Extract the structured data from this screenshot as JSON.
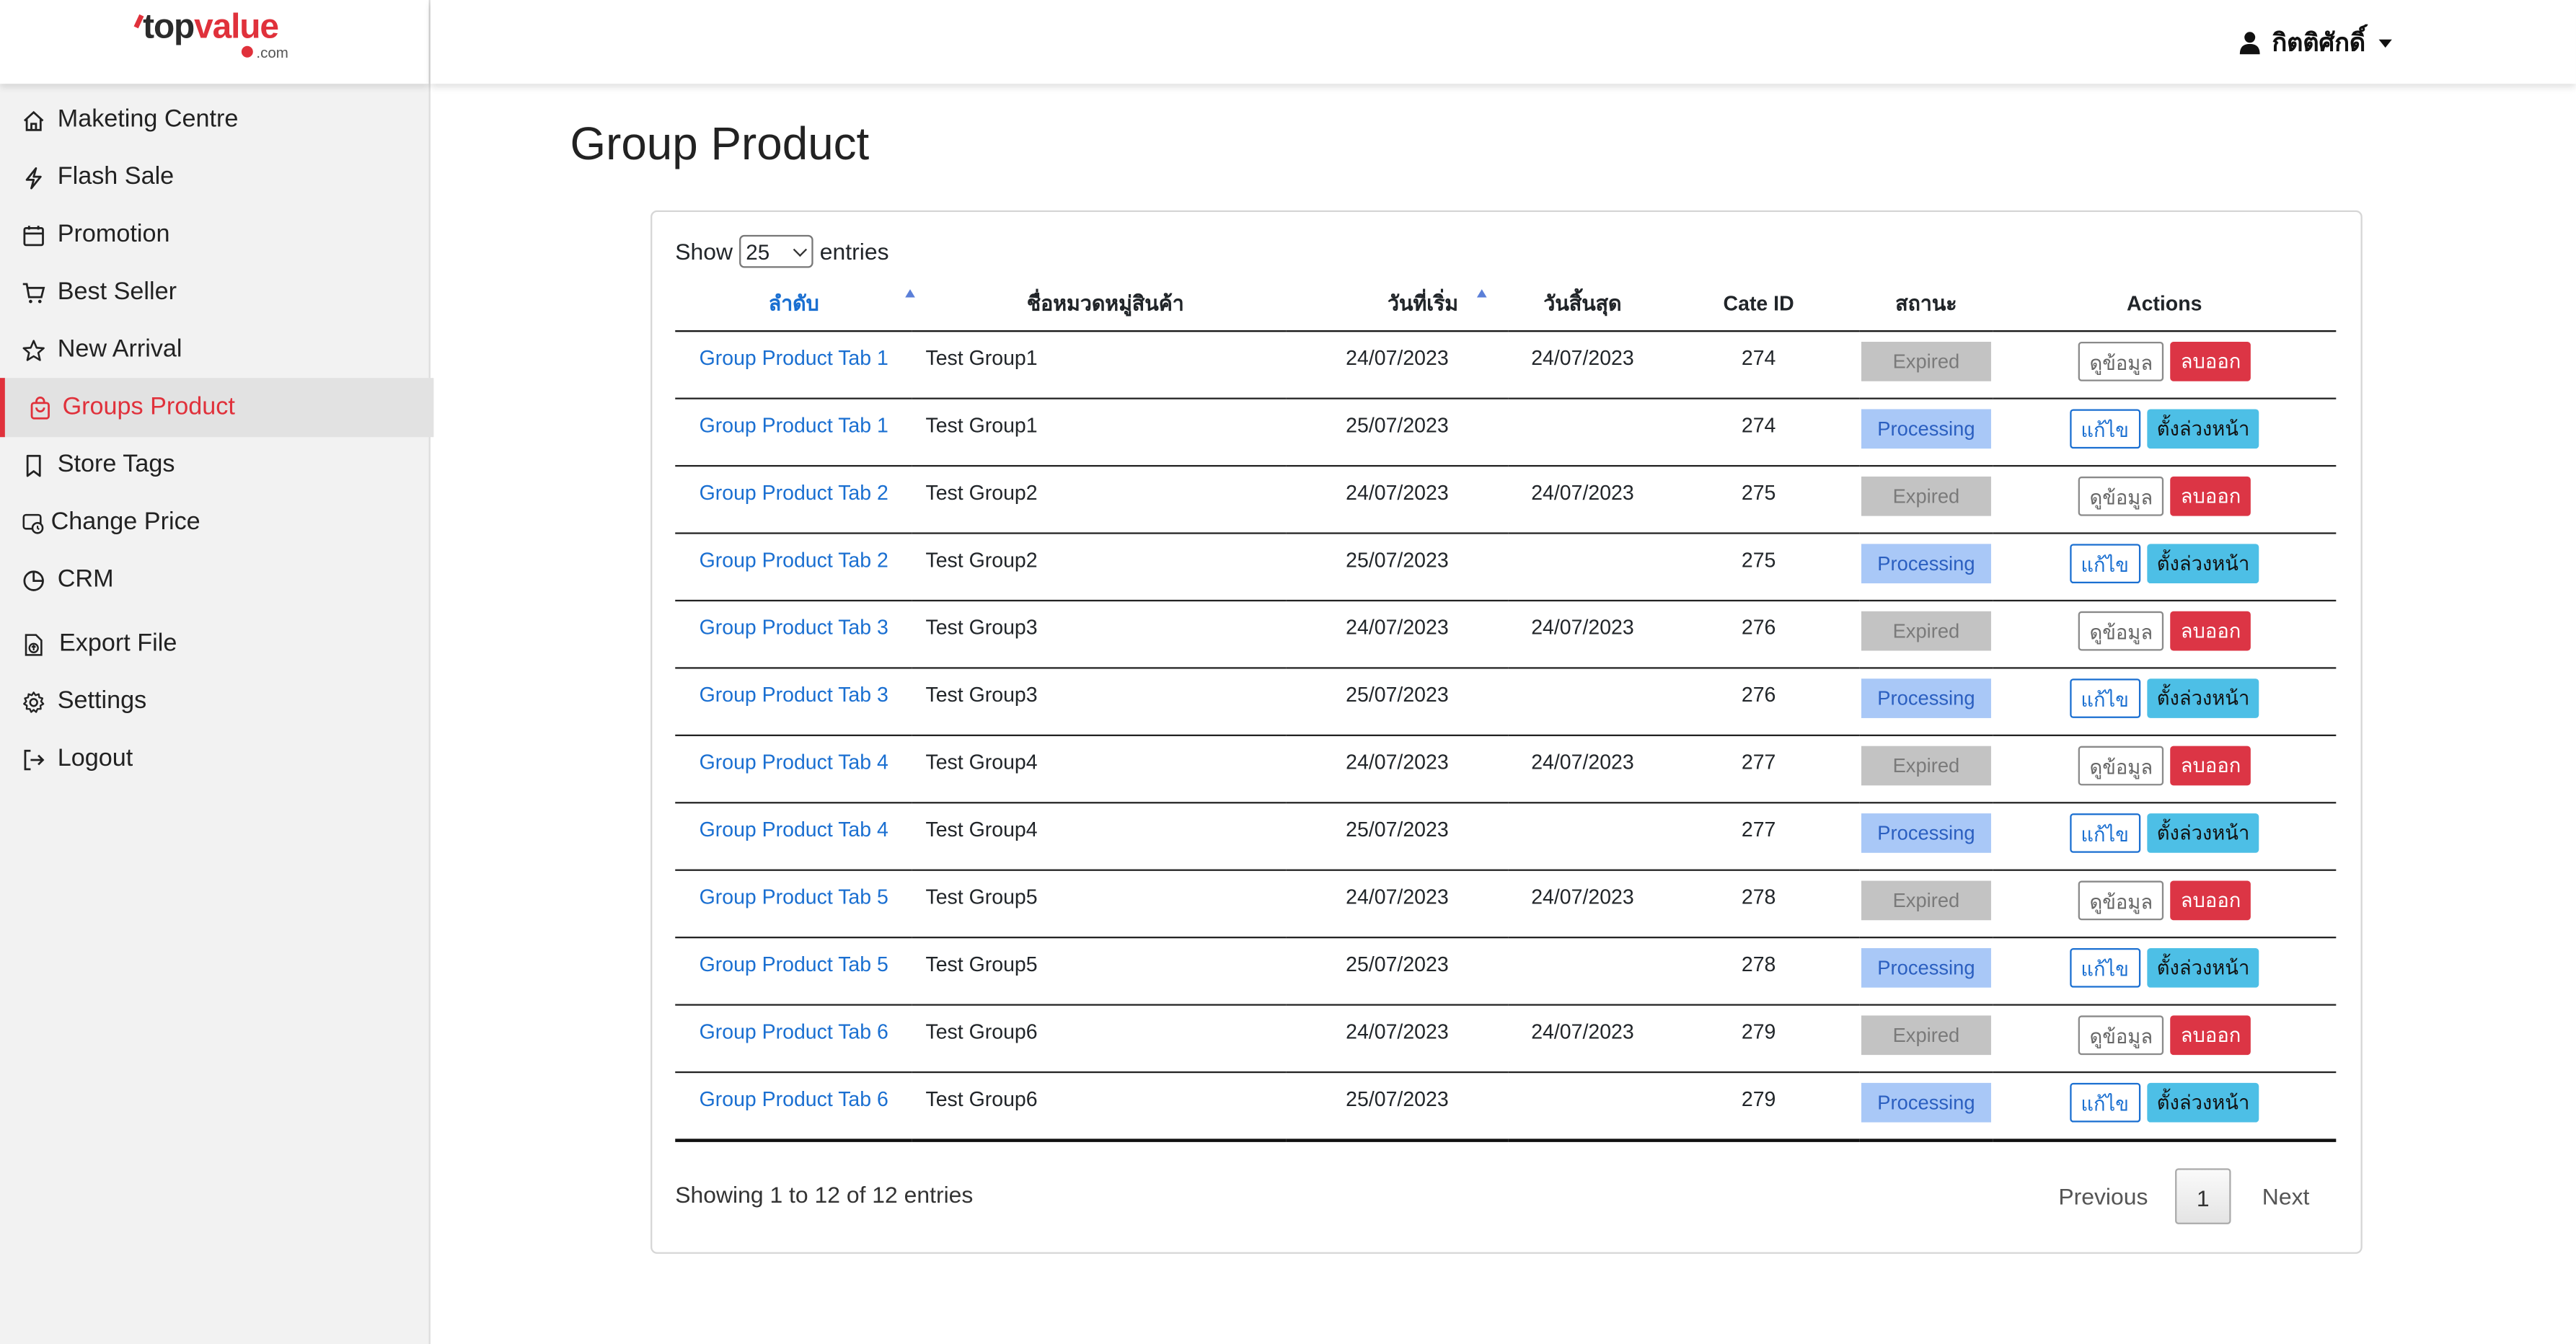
{
  "brand": {
    "logo_main": "top",
    "logo_accent": "value",
    "logo_suffix": ".com"
  },
  "user": {
    "name": "กิตติศักดิ์"
  },
  "sidebar": {
    "items": [
      {
        "label": "Maketing Centre",
        "icon": "home-icon"
      },
      {
        "label": "Flash Sale",
        "icon": "lightning-icon"
      },
      {
        "label": "Promotion",
        "icon": "calendar-icon"
      },
      {
        "label": "Best Seller",
        "icon": "cart-icon"
      },
      {
        "label": "New Arrival",
        "icon": "star-icon"
      },
      {
        "label": "Groups Product",
        "icon": "bag-icon",
        "active": true
      },
      {
        "label": "Store Tags",
        "icon": "bookmark-icon"
      },
      {
        "label": "Change Price",
        "icon": "price-tag-icon"
      },
      {
        "label": "CRM",
        "icon": "pie-chart-icon"
      },
      {
        "label": "Export File",
        "icon": "export-icon"
      },
      {
        "label": "Settings",
        "icon": "gear-icon"
      },
      {
        "label": "Logout",
        "icon": "logout-icon"
      }
    ]
  },
  "page": {
    "title": "Group Product"
  },
  "table_controls": {
    "show_label": "Show",
    "entries_value": "25",
    "entries_label": "entries"
  },
  "table": {
    "headers": [
      "ลำดับ",
      "ชื่อหมวดหมู่สินค้า",
      "วันที่เริ่ม",
      "วันสิ้นสุด",
      "Cate ID",
      "สถานะ",
      "Actions"
    ],
    "rows": [
      {
        "name": "Group Product Tab 1",
        "category": "Test Group1",
        "start": "24/07/2023",
        "end": "24/07/2023",
        "cate_id": "274",
        "status": "Expired",
        "btn1": "ดูข้อมูล",
        "btn2": "ลบออก"
      },
      {
        "name": "Group Product Tab 1",
        "category": "Test Group1",
        "start": "25/07/2023",
        "end": "",
        "cate_id": "274",
        "status": "Processing",
        "btn1": "แก้ไข",
        "btn2": "ตั้งล่วงหน้า"
      },
      {
        "name": "Group Product Tab 2",
        "category": "Test Group2",
        "start": "24/07/2023",
        "end": "24/07/2023",
        "cate_id": "275",
        "status": "Expired",
        "btn1": "ดูข้อมูล",
        "btn2": "ลบออก"
      },
      {
        "name": "Group Product Tab 2",
        "category": "Test Group2",
        "start": "25/07/2023",
        "end": "",
        "cate_id": "275",
        "status": "Processing",
        "btn1": "แก้ไข",
        "btn2": "ตั้งล่วงหน้า"
      },
      {
        "name": "Group Product Tab 3",
        "category": "Test Group3",
        "start": "24/07/2023",
        "end": "24/07/2023",
        "cate_id": "276",
        "status": "Expired",
        "btn1": "ดูข้อมูล",
        "btn2": "ลบออก"
      },
      {
        "name": "Group Product Tab 3",
        "category": "Test Group3",
        "start": "25/07/2023",
        "end": "",
        "cate_id": "276",
        "status": "Processing",
        "btn1": "แก้ไข",
        "btn2": "ตั้งล่วงหน้า"
      },
      {
        "name": "Group Product Tab 4",
        "category": "Test Group4",
        "start": "24/07/2023",
        "end": "24/07/2023",
        "cate_id": "277",
        "status": "Expired",
        "btn1": "ดูข้อมูล",
        "btn2": "ลบออก"
      },
      {
        "name": "Group Product Tab 4",
        "category": "Test Group4",
        "start": "25/07/2023",
        "end": "",
        "cate_id": "277",
        "status": "Processing",
        "btn1": "แก้ไข",
        "btn2": "ตั้งล่วงหน้า"
      },
      {
        "name": "Group Product Tab 5",
        "category": "Test Group5",
        "start": "24/07/2023",
        "end": "24/07/2023",
        "cate_id": "278",
        "status": "Expired",
        "btn1": "ดูข้อมูล",
        "btn2": "ลบออก"
      },
      {
        "name": "Group Product Tab 5",
        "category": "Test Group5",
        "start": "25/07/2023",
        "end": "",
        "cate_id": "278",
        "status": "Processing",
        "btn1": "แก้ไข",
        "btn2": "ตั้งล่วงหน้า"
      },
      {
        "name": "Group Product Tab 6",
        "category": "Test Group6",
        "start": "24/07/2023",
        "end": "24/07/2023",
        "cate_id": "279",
        "status": "Expired",
        "btn1": "ดูข้อมูล",
        "btn2": "ลบออก"
      },
      {
        "name": "Group Product Tab 6",
        "category": "Test Group6",
        "start": "25/07/2023",
        "end": "",
        "cate_id": "279",
        "status": "Processing",
        "btn1": "แก้ไข",
        "btn2": "ตั้งล่วงหน้า"
      }
    ]
  },
  "footer": {
    "info": "Showing 1 to 12 of 12 entries",
    "prev": "Previous",
    "page": "1",
    "next": "Next"
  },
  "colors": {
    "accent": "#e0313b",
    "link": "#1a6fd1",
    "expired_bg": "#c3c3c3",
    "processing_bg": "#a9c8f7",
    "delete_bg": "#dc3545",
    "schedule_bg": "#4dbfe6"
  }
}
